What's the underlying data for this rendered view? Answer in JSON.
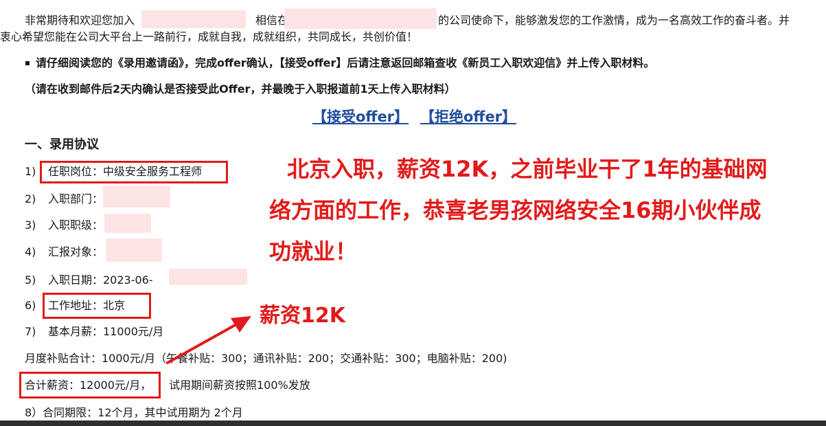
{
  "intro": {
    "line1_a": "非常期待和欢迎您加入",
    "line1_b": "相信在",
    "line1_c": "的公司使命下，能够激发您的工作激情，成为一名高效工作的奋斗者。并",
    "line2": "衷心希望您能在公司大平台上一路前行，成就自我，成就组织，共同成长，共创价值！"
  },
  "notice": "请仔细阅读您的《录用邀请函》，完成offer确认，【接受offer】后请注意返回邮箱查收《新员工入职欢迎信》并上传入职材料。",
  "note": "（请在收到邮件后2天内确认是否接受此Offer，并最晚于入职报道前1天上传入职材料）",
  "actions": {
    "accept": "【接受offer】",
    "reject": "【拒绝offer】"
  },
  "section_title": "一、录用协议",
  "items": {
    "i1_num": "1)",
    "i1_text": "任职岗位：中级安全服务工程师",
    "i2_num": "2)",
    "i2_text": "入职部门：",
    "i3_num": "3)",
    "i3_text": "入职职级：",
    "i4_num": "4)",
    "i4_text": "汇报对象：",
    "i5_num": "5)",
    "i5_text": "入职日期：2023-06-",
    "i6_num": "6)",
    "i6_text": "工作地址：北京",
    "i7_num": "7)",
    "i7_text": "基本月薪：11000元/月",
    "allowance": "月度补贴合计：1000元/月（午餐补贴：300；通讯补贴：200；交通补贴：300；电脑补贴：200)",
    "total_a": "合计薪资：12000元/月，",
    "total_b": "试用期间薪资按照100%发放",
    "i8": "8）合同期限：12个月，其中试用期为 2个月"
  },
  "annotations": {
    "headline_l1": "北京入职，薪资12K，之前毕业干了1年的基础网",
    "headline_l2": "络方面的工作，恭喜老男孩网络安全16期小伙伴成",
    "headline_l3": "功就业！",
    "salary_label": "薪资12K"
  },
  "colors": {
    "annotation_red": "#e21a1a",
    "link_blue": "#1f4e9c",
    "redaction_pink": "#fde4e4"
  }
}
